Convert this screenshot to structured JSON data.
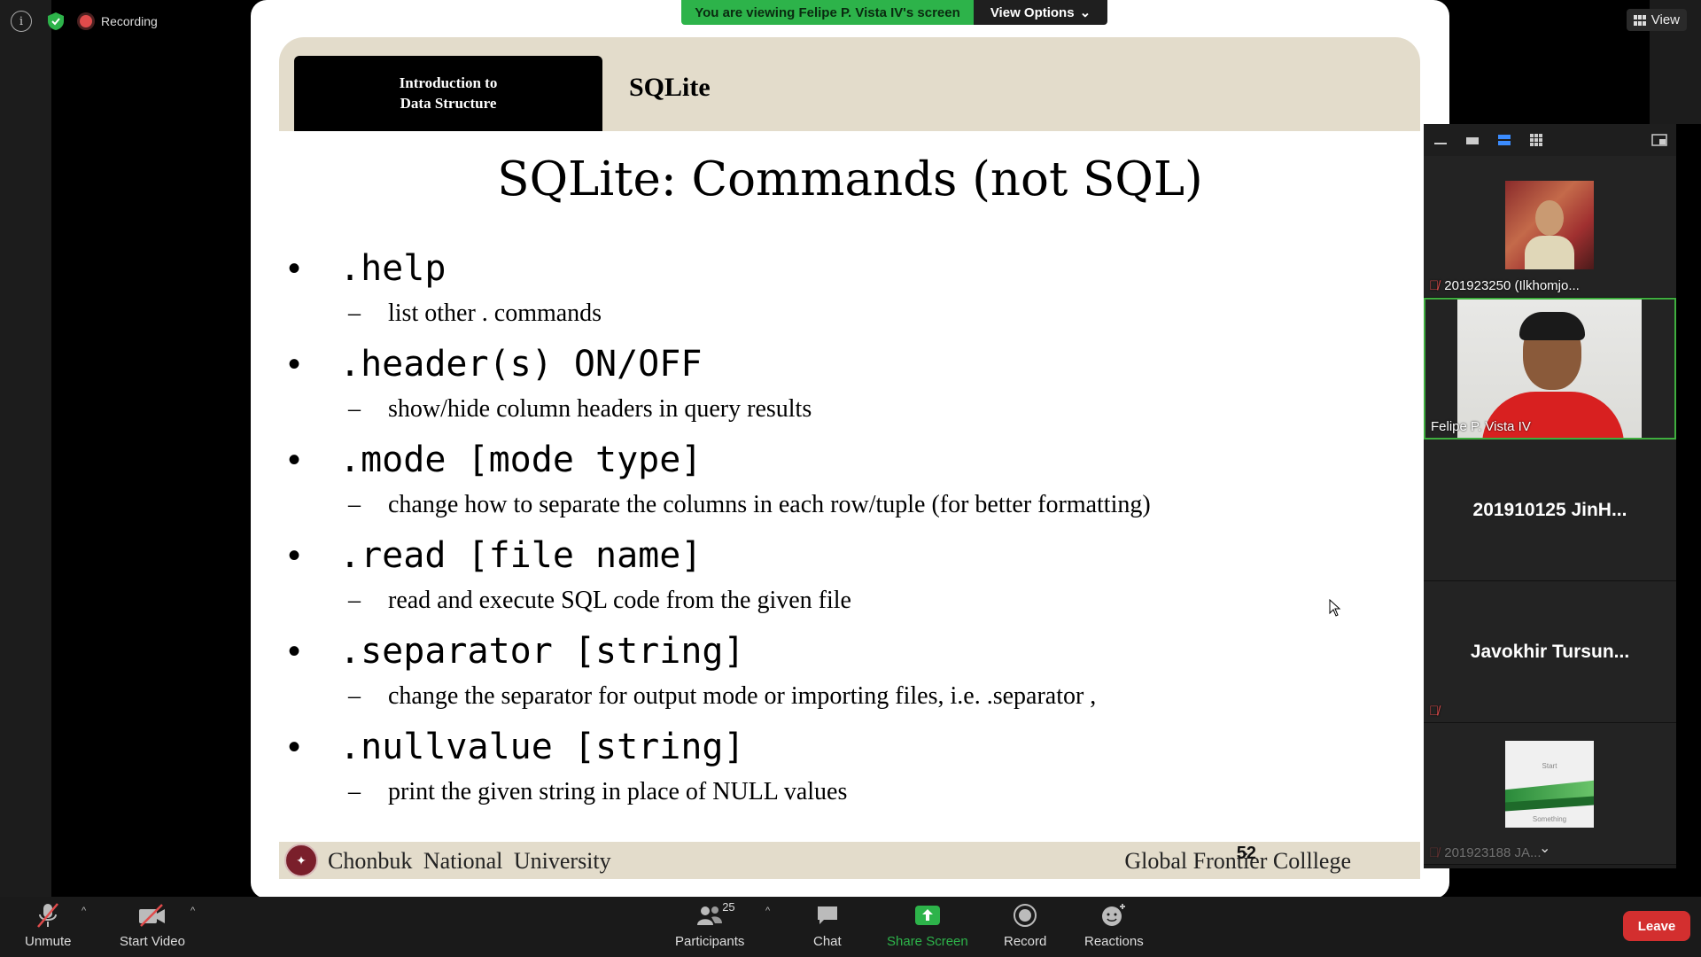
{
  "topbar": {
    "info_icon": "info-icon",
    "security_icon": "shield-check-icon",
    "recording_label": "Recording",
    "view_label": "View"
  },
  "banner": {
    "viewing_text": "You are viewing Felipe P. Vista IV's screen",
    "view_options_label": "View Options"
  },
  "slide": {
    "header_course_line1": "Introduction to",
    "header_course_line2": "Data Structure",
    "header_topic": "SQLite",
    "title": "SQLite: Commands (not SQL)",
    "bullets": [
      {
        "cmd": ".help",
        "desc": "list other . commands"
      },
      {
        "cmd": ".header(s) ON/OFF",
        "desc": "show/hide column headers in query results"
      },
      {
        "cmd": ".mode [mode type]",
        "desc": "change how to separate the columns in each row/tuple (for better formatting)"
      },
      {
        "cmd": ".read [file name]",
        "desc": "read and execute SQL code from the given file"
      },
      {
        "cmd": ".separator [string]",
        "desc": "change the separator for output mode or importing files, i.e. .separator ,"
      },
      {
        "cmd": ".nullvalue [string]",
        "desc": "print the given string in place of NULL values"
      }
    ],
    "footer_left": "Chonbuk  National University",
    "footer_right": "Global Frontier Colllege",
    "page_number": "52"
  },
  "gallery": {
    "participants": [
      {
        "name": "201923250 (Ilkhomjo...",
        "muted": true
      },
      {
        "name": "Felipe P. Vista IV",
        "muted": false
      },
      {
        "name": "201910125  JinH...",
        "muted": false
      },
      {
        "name": "Javokhir  Tursun...",
        "muted": true
      },
      {
        "name": "201923188 JA...",
        "muted": true,
        "thumb_text_top": "Start",
        "thumb_text_bottom": "Something"
      }
    ]
  },
  "toolbar": {
    "unmute": "Unmute",
    "start_video": "Start Video",
    "participants": "Participants",
    "participants_count": "25",
    "chat": "Chat",
    "share_screen": "Share Screen",
    "record": "Record",
    "reactions": "Reactions",
    "leave": "Leave"
  },
  "colors": {
    "share_green": "#2db34a",
    "leave_red": "#d32f2f",
    "slide_band": "#e3dccb",
    "active_speaker_border": "#3fae3f"
  }
}
